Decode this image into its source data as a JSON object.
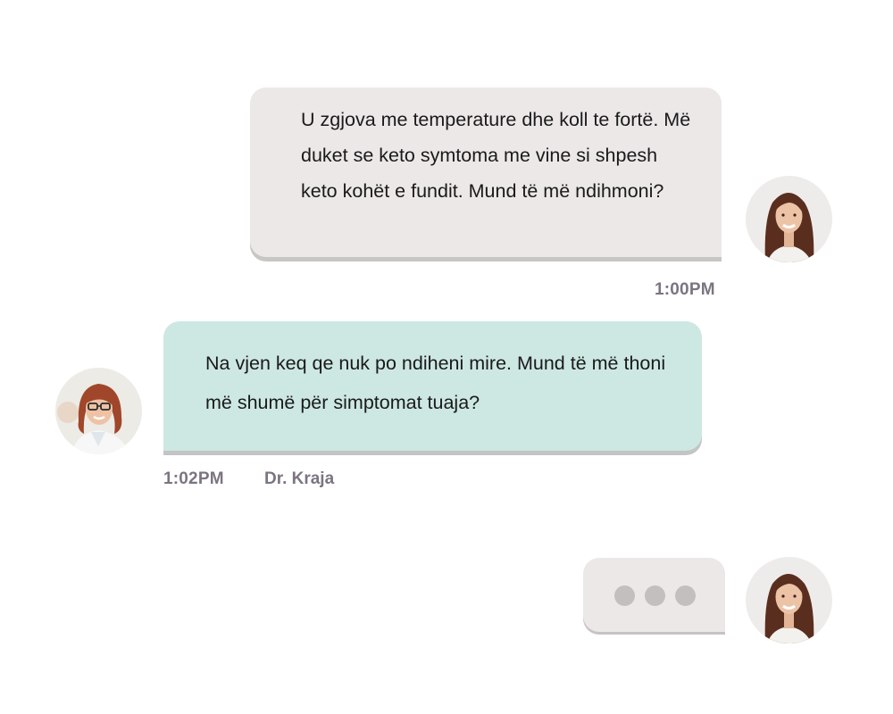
{
  "messages": [
    {
      "sender": "patient",
      "text": "U zgjova me temperature dhe koll te fortë. Më duket se keto symtoma me vine si shpesh keto kohët e fundit. Mund të më ndihmoni?",
      "time": "1:00PM"
    },
    {
      "sender": "doctor",
      "text": "Na vjen keq qe nuk po ndiheni mire. Mund të më thoni më shumë për simptomat tuaja?",
      "time": "1:02PM",
      "name": "Dr. Kraja"
    }
  ],
  "typing_indicator": {
    "dots": 3
  },
  "colors": {
    "patient_bubble": "#ece8e8",
    "doctor_bubble": "#cde8e2",
    "meta_text": "#7c7480",
    "typing_dot": "#c3bfbf"
  },
  "icons": [
    "patient-avatar",
    "doctor-avatar"
  ]
}
